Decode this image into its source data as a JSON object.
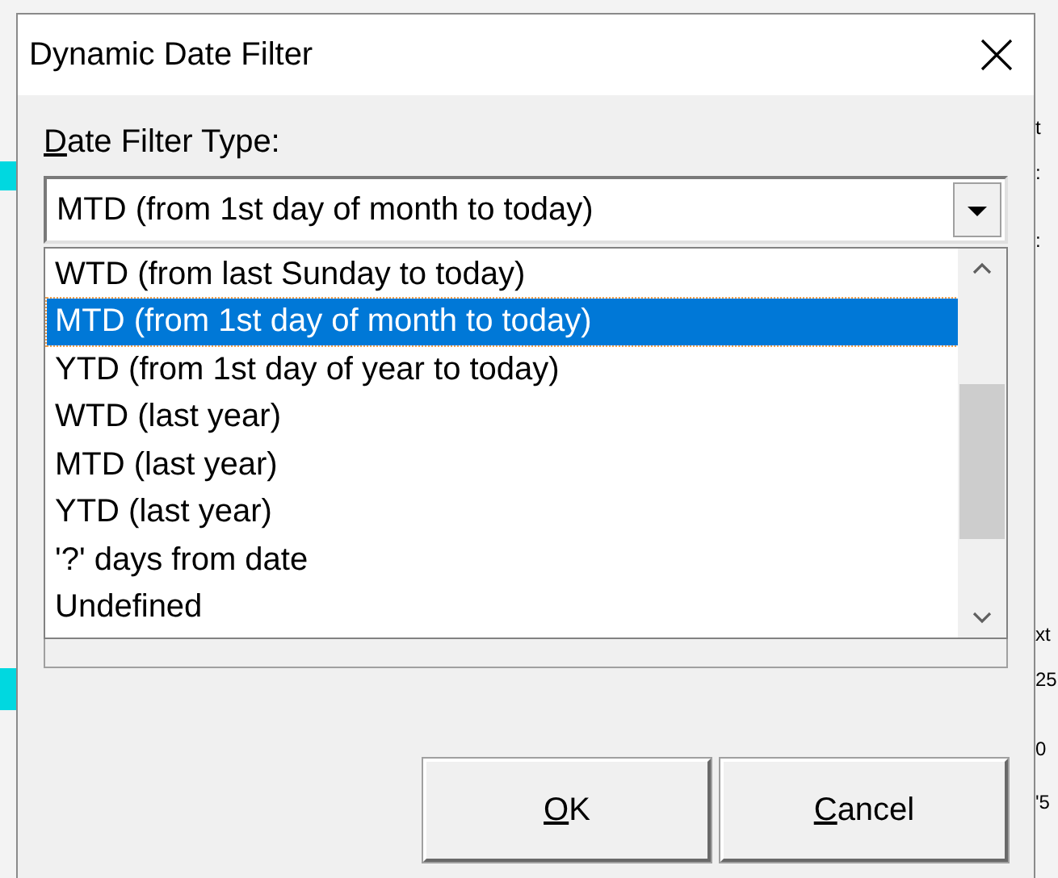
{
  "window": {
    "title": "Dynamic Date Filter"
  },
  "field_label": "Date Filter Type:",
  "combobox": {
    "value": "MTD (from 1st day of month to today)"
  },
  "dropdown_items": [
    {
      "label": "WTD (from last Sunday to today)",
      "selected": false
    },
    {
      "label": "MTD (from 1st day of month to today)",
      "selected": true
    },
    {
      "label": "YTD (from 1st day of year to today)",
      "selected": false
    },
    {
      "label": "WTD (last year)",
      "selected": false
    },
    {
      "label": "MTD (last year)",
      "selected": false
    },
    {
      "label": "YTD (last year)",
      "selected": false
    },
    {
      "label": "'?' days from date",
      "selected": false
    },
    {
      "label": "Undefined",
      "selected": false
    }
  ],
  "buttons": [
    "OK",
    "Cancel"
  ],
  "background_fragments": [
    {
      "text": "t"
    },
    {
      "text": ":"
    },
    {
      "text": ":"
    },
    {
      "text": "xt"
    },
    {
      "text": "25"
    },
    {
      "text": "0"
    },
    {
      "text": "'5"
    }
  ]
}
